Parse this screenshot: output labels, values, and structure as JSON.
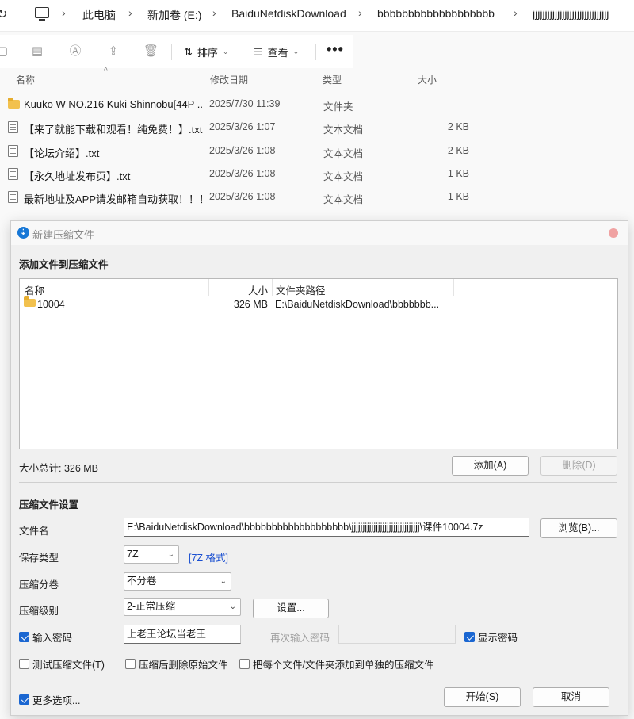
{
  "explorer": {
    "breadcrumb": [
      "此电脑",
      "新加卷 (E:)",
      "BaiduNetdiskDownload",
      "bbbbbbbbbbbbbbbbbbb",
      "jjjjjjjjjjjjjjjjjjjjjjjjjjjjjjj"
    ],
    "toolbar": {
      "sort_label": "排序",
      "view_label": "查看",
      "more_label": "•••"
    },
    "columns": {
      "name": "名称",
      "date": "修改日期",
      "type": "类型",
      "size": "大小"
    },
    "files": [
      {
        "name": "Kuuko W NO.216 Kuki Shinnobu[44P ...",
        "date": "2025/7/30 11:39",
        "type": "文件夹",
        "size": "",
        "icon": "folder-icon"
      },
      {
        "name": "【来了就能下载和观看！纯免费！】.txt",
        "date": "2025/3/26 1:07",
        "type": "文本文档",
        "size": "2 KB",
        "icon": "text-file-icon"
      },
      {
        "name": "【论坛介绍】.txt",
        "date": "2025/3/26 1:08",
        "type": "文本文档",
        "size": "2 KB",
        "icon": "text-file-icon"
      },
      {
        "name": "【永久地址发布页】.txt",
        "date": "2025/3/26 1:08",
        "type": "文本文档",
        "size": "1 KB",
        "icon": "text-file-icon"
      },
      {
        "name": "最新地址及APP请发邮箱自动获取！！！...",
        "date": "2025/3/26 1:08",
        "type": "文本文档",
        "size": "1 KB",
        "icon": "text-file-icon"
      }
    ]
  },
  "dialog": {
    "title": "新建压缩文件",
    "add_section_title": "添加文件到压缩文件",
    "list_columns": {
      "name": "名称",
      "size": "大小",
      "path": "文件夹路径"
    },
    "list_items": [
      {
        "name": "10004",
        "size": "326 MB",
        "path": "E:\\BaiduNetdiskDownload\\bbbbbbb..."
      }
    ],
    "total_size": "大小总计: 326 MB",
    "add_button": "添加(A)",
    "remove_button": "删除(D)",
    "settings_title": "压缩文件设置",
    "filename_label": "文件名",
    "filename_value": "E:\\BaiduNetdiskDownload\\bbbbbbbbbbbbbbbbbbb\\jjjjjjjjjjjjjjjjjjjjjjjjjjjjjjj\\课件10004.7z",
    "browse_button": "浏览(B)...",
    "save_type_label": "保存类型",
    "save_type_value": "7Z",
    "format_link": "[7Z 格式]",
    "split_label": "压缩分卷",
    "split_value": "不分卷",
    "level_label": "压缩级别",
    "level_value": "2-正常压缩",
    "settings_button": "设置...",
    "password_check_label": "输入密码",
    "password_value": "上老王论坛当老王",
    "password_again_label": "再次输入密码",
    "show_password_label": "显示密码",
    "test_archive_label": "测试压缩文件(T)",
    "delete_source_label": "压缩后删除原始文件",
    "separate_archives_label": "把每个文件/文件夹添加到单独的压缩文件",
    "more_options_label": "更多选项...",
    "start_button": "开始(S)",
    "cancel_button": "取消"
  },
  "colors": {
    "accent": "#1a66d1",
    "folder": "#f2c14e",
    "link": "#1a4fd1"
  }
}
